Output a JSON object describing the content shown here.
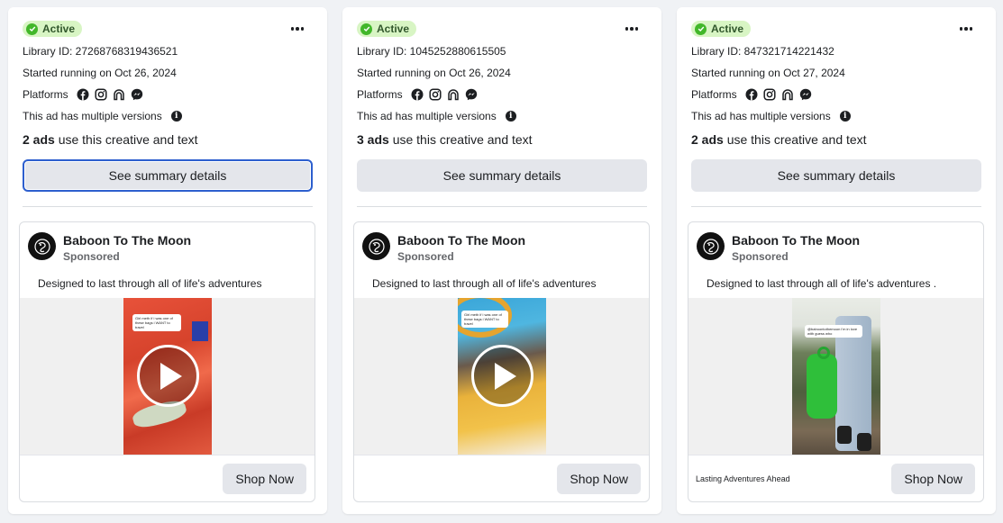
{
  "cards": [
    {
      "status": "Active",
      "library_id": "Library ID: 27268768319436521",
      "started": "Started running on Oct 26, 2024",
      "platforms_label": "Platforms",
      "multiple_versions": "This ad has multiple versions",
      "ads_count": "2 ads",
      "ads_count_suffix": " use this creative and text",
      "summary_button": "See summary details",
      "page_name": "Baboon To The Moon",
      "sponsored": "Sponsored",
      "body": "Designed to last through all of life's adventures",
      "cta": "Shop Now",
      "link_caption": ""
    },
    {
      "status": "Active",
      "library_id": "Library ID: 1045252880615505",
      "started": "Started running on Oct 26, 2024",
      "platforms_label": "Platforms",
      "multiple_versions": "This ad has multiple versions",
      "ads_count": "3 ads",
      "ads_count_suffix": " use this creative and text",
      "summary_button": "See summary details",
      "page_name": "Baboon To The Moon",
      "sponsored": "Sponsored",
      "body": "Designed to last through all of life's adventures",
      "cta": "Shop Now",
      "link_caption": ""
    },
    {
      "status": "Active",
      "library_id": "Library ID: 847321714221432",
      "started": "Started running on Oct 27, 2024",
      "platforms_label": "Platforms",
      "multiple_versions": "This ad has multiple versions",
      "ads_count": "2 ads",
      "ads_count_suffix": " use this creative and text",
      "summary_button": "See summary details",
      "page_name": "Baboon To The Moon",
      "sponsored": "Sponsored",
      "body": "Designed to last through all of life's adventures .",
      "cta": "Shop Now",
      "link_caption": "Lasting Adventures Ahead"
    }
  ],
  "video_captions": [
    "Girl meth if i was one of these bags i WANT to travel",
    "Girl meth if i was one of these bags i WANT to travel",
    "@baboontothemoon i'm in love with guess who"
  ],
  "platform_icons": [
    "facebook-icon",
    "instagram-icon",
    "audience-network-icon",
    "messenger-icon"
  ],
  "colors": {
    "active_badge_bg": "#d8f5c4",
    "active_check": "#42b72a",
    "focus_ring": "#2d5fce",
    "button_bg": "#e4e6eb"
  }
}
